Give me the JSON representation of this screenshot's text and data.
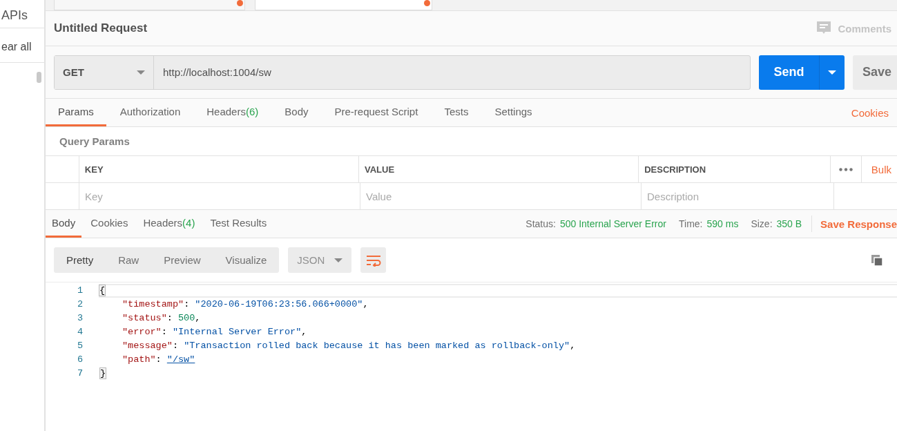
{
  "sidebar": {
    "items": [
      "APIs",
      "ear all"
    ]
  },
  "top_tabs": [
    {
      "selected": false,
      "unsaved": true
    },
    {
      "selected": true,
      "unsaved": true
    }
  ],
  "request": {
    "title": "Untitled Request",
    "comments": "Comments",
    "method": "GET",
    "url": "http://localhost:1004/sw",
    "send": "Send",
    "save": "Save"
  },
  "request_tabs": [
    {
      "label": "Params",
      "selected": true
    },
    {
      "label": "Authorization",
      "selected": false
    },
    {
      "label": "Headers",
      "count": "(6)",
      "selected": false
    },
    {
      "label": "Body",
      "selected": false
    },
    {
      "label": "Pre-request Script",
      "selected": false
    },
    {
      "label": "Tests",
      "selected": false
    },
    {
      "label": "Settings",
      "selected": false
    }
  ],
  "cookies_link": "Cookies",
  "query_params": {
    "title": "Query Params",
    "columns": [
      "KEY",
      "VALUE",
      "DESCRIPTION"
    ],
    "bulk_edit": "Bulk",
    "placeholders": [
      "Key",
      "Value",
      "Description"
    ]
  },
  "response_tabs": [
    {
      "label": "Body",
      "selected": true
    },
    {
      "label": "Cookies",
      "selected": false
    },
    {
      "label": "Headers",
      "count": "(4)",
      "selected": false
    },
    {
      "label": "Test Results",
      "selected": false
    }
  ],
  "response_meta": [
    {
      "label": "Status:",
      "value": "500 Internal Server Error"
    },
    {
      "label": "Time:",
      "value": "590 ms"
    },
    {
      "label": "Size:",
      "value": "350 B"
    }
  ],
  "save_response": "Save Response",
  "view_modes": [
    {
      "label": "Pretty",
      "selected": true
    },
    {
      "label": "Raw",
      "selected": false
    },
    {
      "label": "Preview",
      "selected": false
    },
    {
      "label": "Visualize",
      "selected": false
    }
  ],
  "format": "JSON",
  "response_body": {
    "line_numbers": [
      "1",
      "2",
      "3",
      "4",
      "5",
      "6",
      "7"
    ],
    "open": "{",
    "close": "}",
    "entries": [
      {
        "key": "\"timestamp\"",
        "colon": ":",
        "value": "\"2020-06-19T06:23:56.066+0000\"",
        "kind": "string",
        "comma": ","
      },
      {
        "key": "\"status\"",
        "colon": ":",
        "value": "500",
        "kind": "number",
        "comma": ","
      },
      {
        "key": "\"error\"",
        "colon": ":",
        "value": "\"Internal Server Error\"",
        "kind": "string",
        "comma": ","
      },
      {
        "key": "\"message\"",
        "colon": ":",
        "value": "\"Transaction rolled back because it has been marked as rollback-only\"",
        "kind": "string",
        "comma": ","
      },
      {
        "key": "\"path\"",
        "colon": ":",
        "value": "\"/sw\"",
        "kind": "link"
      }
    ]
  }
}
